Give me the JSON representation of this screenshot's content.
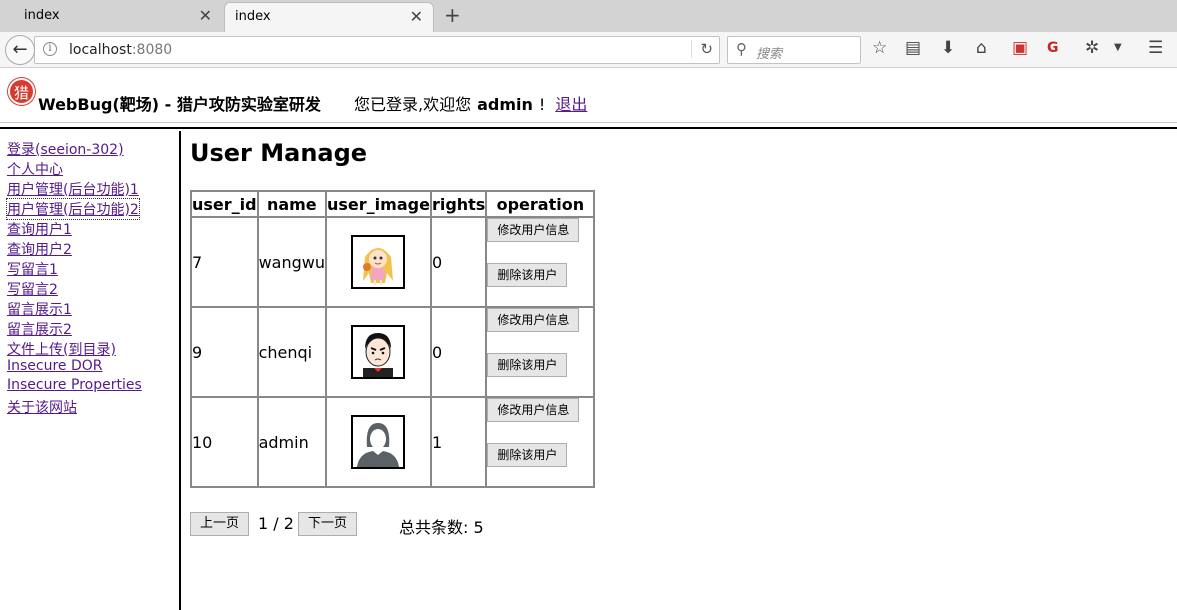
{
  "browser": {
    "tabs": [
      {
        "title": "index",
        "active": false
      },
      {
        "title": "index",
        "active": true
      }
    ],
    "url_host": "localhost",
    "url_port": ":8080",
    "search_placeholder": "搜索"
  },
  "header": {
    "site_title": "WebBug(靶场) - 猎户攻防实验室研发",
    "welcome_text": "您已登录,欢迎您",
    "username": "admin",
    "exclaim": "!",
    "logout": "退出",
    "logo_char": "猎"
  },
  "sidebar": {
    "items": [
      {
        "label": "登录(seeion-302)"
      },
      {
        "label": "个人中心"
      },
      {
        "label": "用户管理(后台功能)1"
      },
      {
        "label": "用户管理(后台功能)2"
      },
      {
        "label": "查询用户1"
      },
      {
        "label": "查询用户2"
      },
      {
        "label": "写留言1"
      },
      {
        "label": "写留言2"
      },
      {
        "label": "留言展示1"
      },
      {
        "label": "留言展示2"
      },
      {
        "label": "文件上传(到目录)"
      },
      {
        "label": "Insecure DOR"
      },
      {
        "label": "Insecure Properties"
      },
      {
        "label": "关于该网站"
      }
    ]
  },
  "main": {
    "title": "User Manage",
    "columns": [
      "user_id",
      "name",
      "user_image",
      "rights",
      "operation"
    ],
    "rows": [
      {
        "user_id": "7",
        "name": "wangwu",
        "rights": "0",
        "avatar": "cartoon-girl-avatar"
      },
      {
        "user_id": "9",
        "name": "chenqi",
        "rights": "0",
        "avatar": "cartoon-boy-avatar"
      },
      {
        "user_id": "10",
        "name": "admin",
        "rights": "1",
        "avatar": "silhouette-avatar"
      }
    ],
    "edit_label": "修改用户信息",
    "delete_label": "删除该用户",
    "pager": {
      "prev": "上一页",
      "page_info": "1 / 2",
      "next": "下一页",
      "total": "总共条数: 5"
    }
  }
}
